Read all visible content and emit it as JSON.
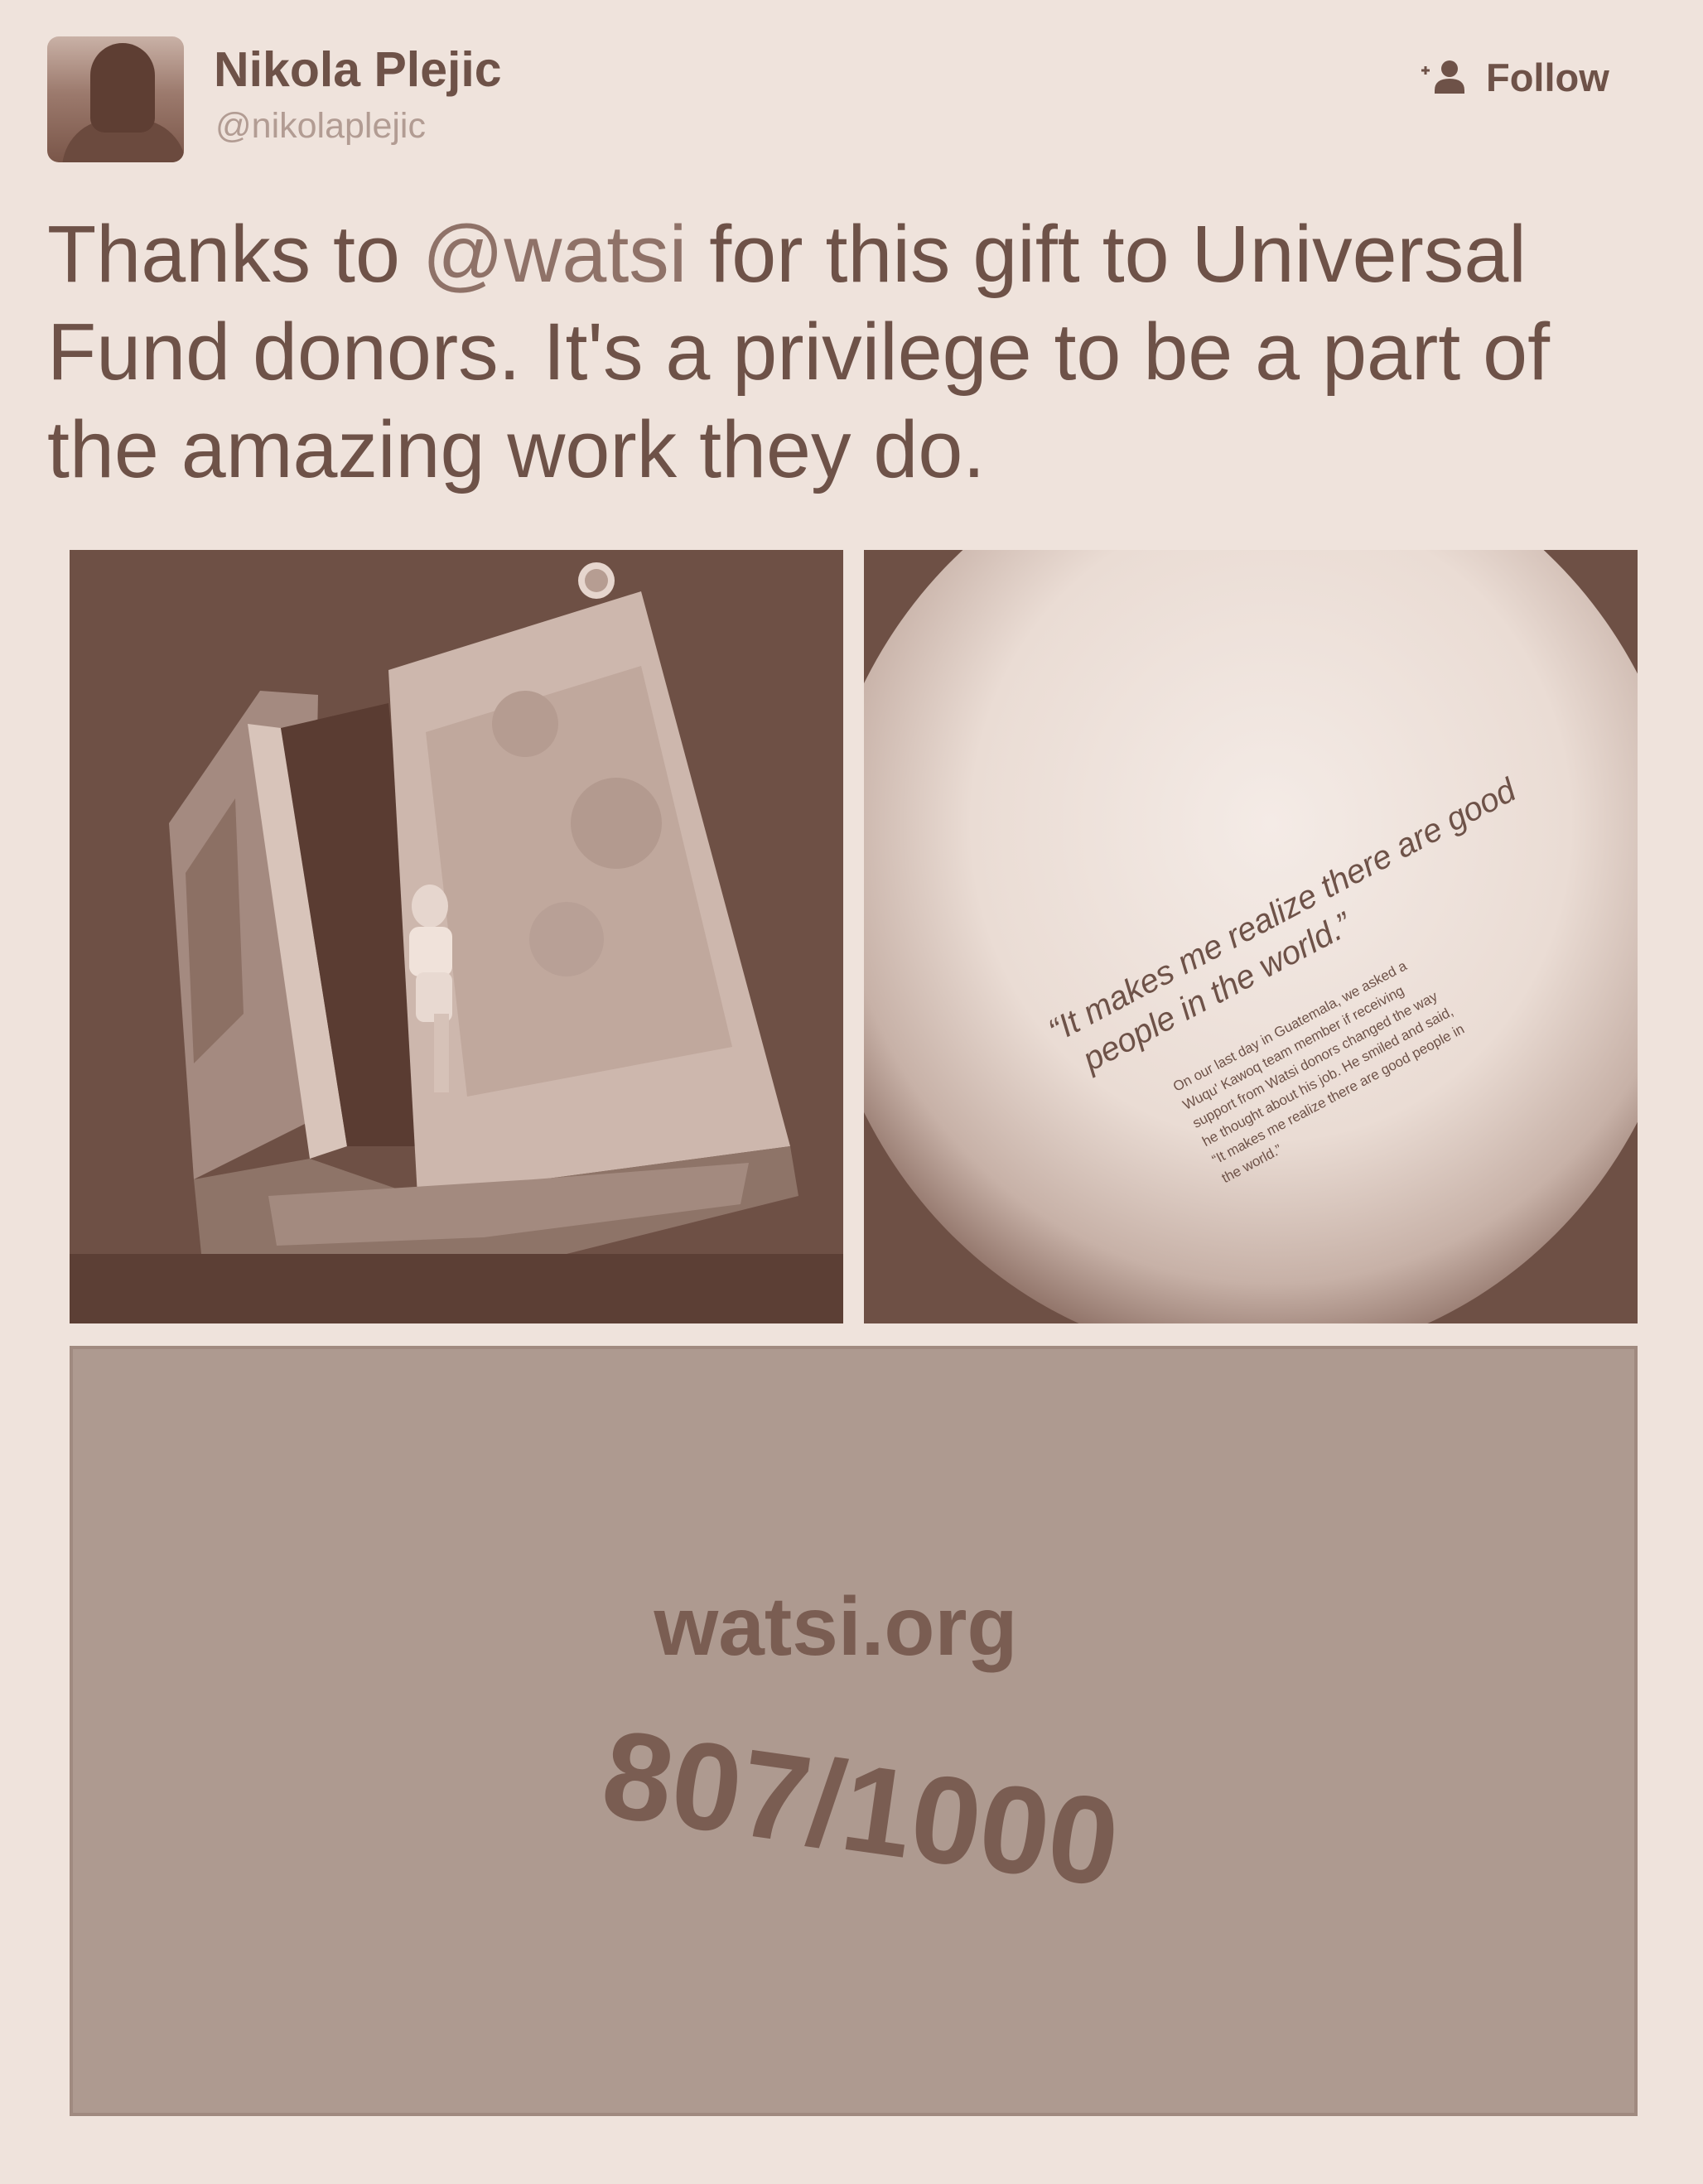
{
  "author": {
    "display_name": "Nikola Plejic",
    "handle": "@nikolaplejic"
  },
  "follow_button": {
    "label": "Follow",
    "icon": "follow-person-plus-icon"
  },
  "tweet": {
    "text_before_mention": "Thanks to ",
    "mention": "@watsi",
    "text_after_mention": " for this gift to Universal Fund donors. It's a privilege to be a part of the amazing work they do."
  },
  "media": {
    "photo_1": {
      "content": "doorway-with-child"
    },
    "photo_2": {
      "quote": "“It makes me realize there are good people in the world.”",
      "body_lines": [
        "On our last day in Guatemala, we asked a",
        "Wuqu' Kawoq team member if receiving",
        "support from Watsi donors changed the way",
        "he thought about his job. He smiled and said,",
        "“It makes me realize there are good people in",
        "the world.”"
      ]
    },
    "photo_3": {
      "site": "watsi.org",
      "handwritten_number": "807/1000"
    }
  },
  "colors": {
    "background": "#efe3dc",
    "text": "#6e5248",
    "muted": "#b29c93",
    "photo_dark": "#6e5045",
    "card": "#ae9a90"
  }
}
